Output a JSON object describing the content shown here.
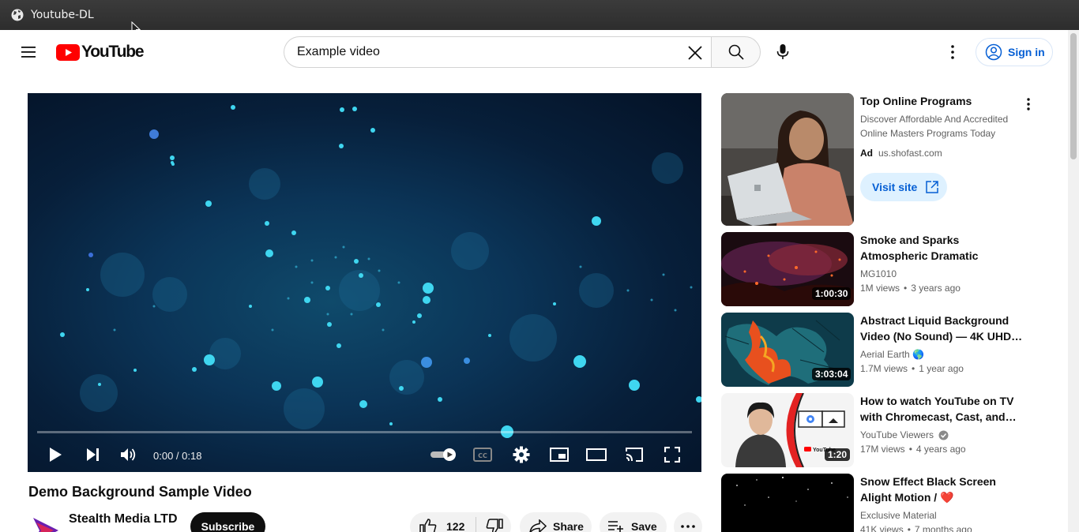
{
  "window": {
    "title": "Youtube-DL"
  },
  "masthead": {
    "brand": "YouTube",
    "search_value": "Example video",
    "signin_label": "Sign in"
  },
  "player": {
    "time": "0:00 / 0:18",
    "progress": 0
  },
  "video": {
    "title": "Demo Background Sample Video",
    "channel": "Stealth Media LTD",
    "subscribe_label": "Subscribe",
    "likes": "122",
    "share_label": "Share",
    "save_label": "Save"
  },
  "ad": {
    "title": "Top Online Programs",
    "desc_line1": "Discover Affordable And Accredited",
    "desc_line2": "Online Masters Programs Today",
    "badge": "Ad",
    "domain": "us.shofast.com",
    "button": "Visit site"
  },
  "recommendations": [
    {
      "title": "Smoke and Sparks Atmospheric Dramatic Background video |…",
      "channel": "MG1010",
      "views": "1M views",
      "age": "3 years ago",
      "duration": "1:00:30"
    },
    {
      "title": "Abstract Liquid Background Video (No Sound) — 4K UHD…",
      "channel": "Aerial Earth 🌎",
      "views": "1.7M views",
      "age": "1 year ago",
      "duration": "3:03:04"
    },
    {
      "title": "How to watch YouTube on TV with Chromecast, Cast, and…",
      "channel": "YouTube Viewers",
      "views": "17M views",
      "age": "4 years ago",
      "duration": "1:20"
    },
    {
      "title": "Snow Effect Black Screen Alight Motion / ❤️",
      "channel": "Exclusive Material",
      "views": "41K views",
      "age": "7 months ago",
      "duration": ""
    }
  ],
  "colors": {
    "youtube_red": "#ff0000",
    "link_blue": "#065fd4"
  }
}
